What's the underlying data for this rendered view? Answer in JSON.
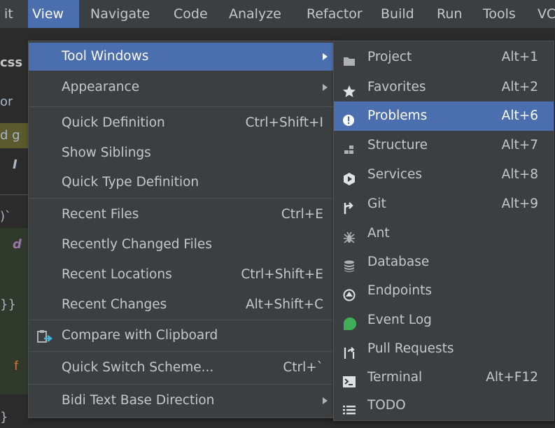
{
  "menubar": {
    "items": [
      {
        "label": "it"
      },
      {
        "label": "View"
      },
      {
        "label": "Navigate"
      },
      {
        "label": "Code"
      },
      {
        "label": "Analyze"
      },
      {
        "label": "Refactor"
      },
      {
        "label": "Build"
      },
      {
        "label": "Run"
      },
      {
        "label": "Tools"
      },
      {
        "label": "VC"
      }
    ]
  },
  "background": {
    "fragments": [
      "css",
      "or",
      "d g",
      "I",
      ")`",
      "d",
      "}}",
      "f",
      "}"
    ]
  },
  "view_menu": {
    "items": [
      {
        "label": "Tool Windows",
        "shortcut": "",
        "submenu": true
      },
      {
        "label": "Appearance",
        "shortcut": "",
        "submenu": true
      },
      {
        "label": "Quick Definition",
        "shortcut": "Ctrl+Shift+I"
      },
      {
        "label": "Show Siblings",
        "shortcut": ""
      },
      {
        "label": "Quick Type Definition",
        "shortcut": ""
      },
      {
        "label": "Recent Files",
        "shortcut": "Ctrl+E"
      },
      {
        "label": "Recently Changed Files",
        "shortcut": ""
      },
      {
        "label": "Recent Locations",
        "shortcut": "Ctrl+Shift+E"
      },
      {
        "label": "Recent Changes",
        "shortcut": "Alt+Shift+C"
      },
      {
        "label": "Compare with Clipboard",
        "shortcut": "",
        "icon": "compare-clipboard-icon"
      },
      {
        "label": "Quick Switch Scheme...",
        "shortcut": "Ctrl+`"
      },
      {
        "label": "Bidi Text Base Direction",
        "shortcut": "",
        "submenu": true
      }
    ]
  },
  "tool_windows": {
    "items": [
      {
        "label": "Project",
        "shortcut": "Alt+1",
        "icon": "folder-icon"
      },
      {
        "label": "Favorites",
        "shortcut": "Alt+2",
        "icon": "star-icon"
      },
      {
        "label": "Problems",
        "shortcut": "Alt+6",
        "icon": "problems-icon"
      },
      {
        "label": "Structure",
        "shortcut": "Alt+7",
        "icon": "structure-icon"
      },
      {
        "label": "Services",
        "shortcut": "Alt+8",
        "icon": "services-icon"
      },
      {
        "label": "Git",
        "shortcut": "Alt+9",
        "icon": "git-icon"
      },
      {
        "label": "Ant",
        "shortcut": "",
        "icon": "ant-icon"
      },
      {
        "label": "Database",
        "shortcut": "",
        "icon": "database-icon"
      },
      {
        "label": "Endpoints",
        "shortcut": "",
        "icon": "endpoints-icon"
      },
      {
        "label": "Event Log",
        "shortcut": "",
        "icon": "event-log-icon"
      },
      {
        "label": "Pull Requests",
        "shortcut": "",
        "icon": "pull-requests-icon"
      },
      {
        "label": "Terminal",
        "shortcut": "Alt+F12",
        "icon": "terminal-icon"
      },
      {
        "label": "TODO",
        "shortcut": "",
        "icon": "todo-icon"
      }
    ]
  },
  "colors": {
    "selection": "#4b6eaf",
    "menu_bg": "#3c3f41",
    "text": "#c7c7c7",
    "event_log_green": "#3fae56"
  }
}
